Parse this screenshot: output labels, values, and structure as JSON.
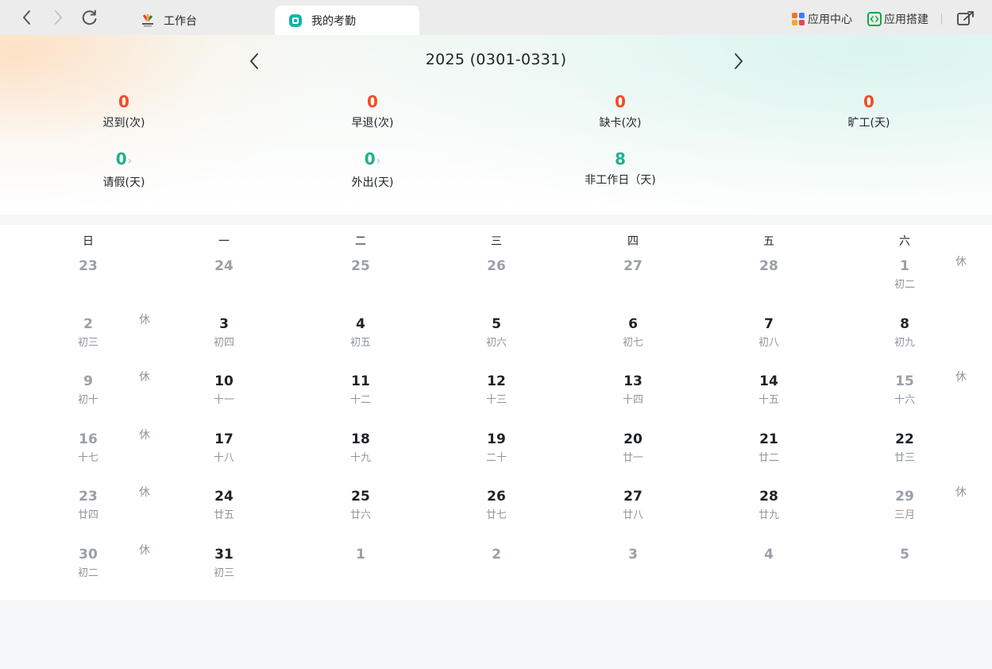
{
  "tabs": [
    {
      "label": "工作台",
      "icon": "workbench-logo-icon"
    },
    {
      "label": "我的考勤",
      "icon": "attendance-icon"
    }
  ],
  "tools": {
    "app_center": "应用中心",
    "app_builder": "应用搭建"
  },
  "period": "2025 (0301-0331)",
  "stats": {
    "late": {
      "value": "0",
      "label": "迟到(次)"
    },
    "early_leave": {
      "value": "0",
      "label": "早退(次)"
    },
    "missing_card": {
      "value": "0",
      "label": "缺卡(次)"
    },
    "absent": {
      "value": "0",
      "label": "旷工(天)"
    },
    "leave": {
      "value": "0",
      "label": "请假(天)"
    },
    "out": {
      "value": "0",
      "label": "外出(天)"
    },
    "non_workday": {
      "value": "8",
      "label": "非工作日（天)"
    }
  },
  "colors": {
    "red": "#f54a27",
    "green": "#20b08d"
  },
  "weekdays": [
    "日",
    "一",
    "二",
    "三",
    "四",
    "五",
    "六"
  ],
  "rest_label": "休",
  "weeks": [
    [
      {
        "d": "23",
        "l": "",
        "m": true,
        "r": false
      },
      {
        "d": "24",
        "l": "",
        "m": true,
        "r": false
      },
      {
        "d": "25",
        "l": "",
        "m": true,
        "r": false
      },
      {
        "d": "26",
        "l": "",
        "m": true,
        "r": false
      },
      {
        "d": "27",
        "l": "",
        "m": true,
        "r": false
      },
      {
        "d": "28",
        "l": "",
        "m": true,
        "r": false
      },
      {
        "d": "1",
        "l": "初二",
        "m": true,
        "r": true
      }
    ],
    [
      {
        "d": "2",
        "l": "初三",
        "m": true,
        "r": true
      },
      {
        "d": "3",
        "l": "初四",
        "m": false,
        "r": false
      },
      {
        "d": "4",
        "l": "初五",
        "m": false,
        "r": false
      },
      {
        "d": "5",
        "l": "初六",
        "m": false,
        "r": false
      },
      {
        "d": "6",
        "l": "初七",
        "m": false,
        "r": false
      },
      {
        "d": "7",
        "l": "初八",
        "m": false,
        "r": false
      },
      {
        "d": "8",
        "l": "初九",
        "m": false,
        "r": false
      }
    ],
    [
      {
        "d": "9",
        "l": "初十",
        "m": true,
        "r": true
      },
      {
        "d": "10",
        "l": "十一",
        "m": false,
        "r": false
      },
      {
        "d": "11",
        "l": "十二",
        "m": false,
        "r": false
      },
      {
        "d": "12",
        "l": "十三",
        "m": false,
        "r": false
      },
      {
        "d": "13",
        "l": "十四",
        "m": false,
        "r": false
      },
      {
        "d": "14",
        "l": "十五",
        "m": false,
        "r": false
      },
      {
        "d": "15",
        "l": "十六",
        "m": true,
        "r": true
      }
    ],
    [
      {
        "d": "16",
        "l": "十七",
        "m": true,
        "r": true
      },
      {
        "d": "17",
        "l": "十八",
        "m": false,
        "r": false
      },
      {
        "d": "18",
        "l": "十九",
        "m": false,
        "r": false
      },
      {
        "d": "19",
        "l": "二十",
        "m": false,
        "r": false
      },
      {
        "d": "20",
        "l": "廿一",
        "m": false,
        "r": false
      },
      {
        "d": "21",
        "l": "廿二",
        "m": false,
        "r": false
      },
      {
        "d": "22",
        "l": "廿三",
        "m": false,
        "r": false
      }
    ],
    [
      {
        "d": "23",
        "l": "廿四",
        "m": true,
        "r": true
      },
      {
        "d": "24",
        "l": "廿五",
        "m": false,
        "r": false
      },
      {
        "d": "25",
        "l": "廿六",
        "m": false,
        "r": false
      },
      {
        "d": "26",
        "l": "廿七",
        "m": false,
        "r": false
      },
      {
        "d": "27",
        "l": "廿八",
        "m": false,
        "r": false
      },
      {
        "d": "28",
        "l": "廿九",
        "m": false,
        "r": false
      },
      {
        "d": "29",
        "l": "三月",
        "m": true,
        "r": true
      }
    ],
    [
      {
        "d": "30",
        "l": "初二",
        "m": true,
        "r": true
      },
      {
        "d": "31",
        "l": "初三",
        "m": false,
        "r": false
      },
      {
        "d": "1",
        "l": "",
        "m": true,
        "r": false
      },
      {
        "d": "2",
        "l": "",
        "m": true,
        "r": false
      },
      {
        "d": "3",
        "l": "",
        "m": true,
        "r": false
      },
      {
        "d": "4",
        "l": "",
        "m": true,
        "r": false
      },
      {
        "d": "5",
        "l": "",
        "m": true,
        "r": false
      }
    ]
  ]
}
